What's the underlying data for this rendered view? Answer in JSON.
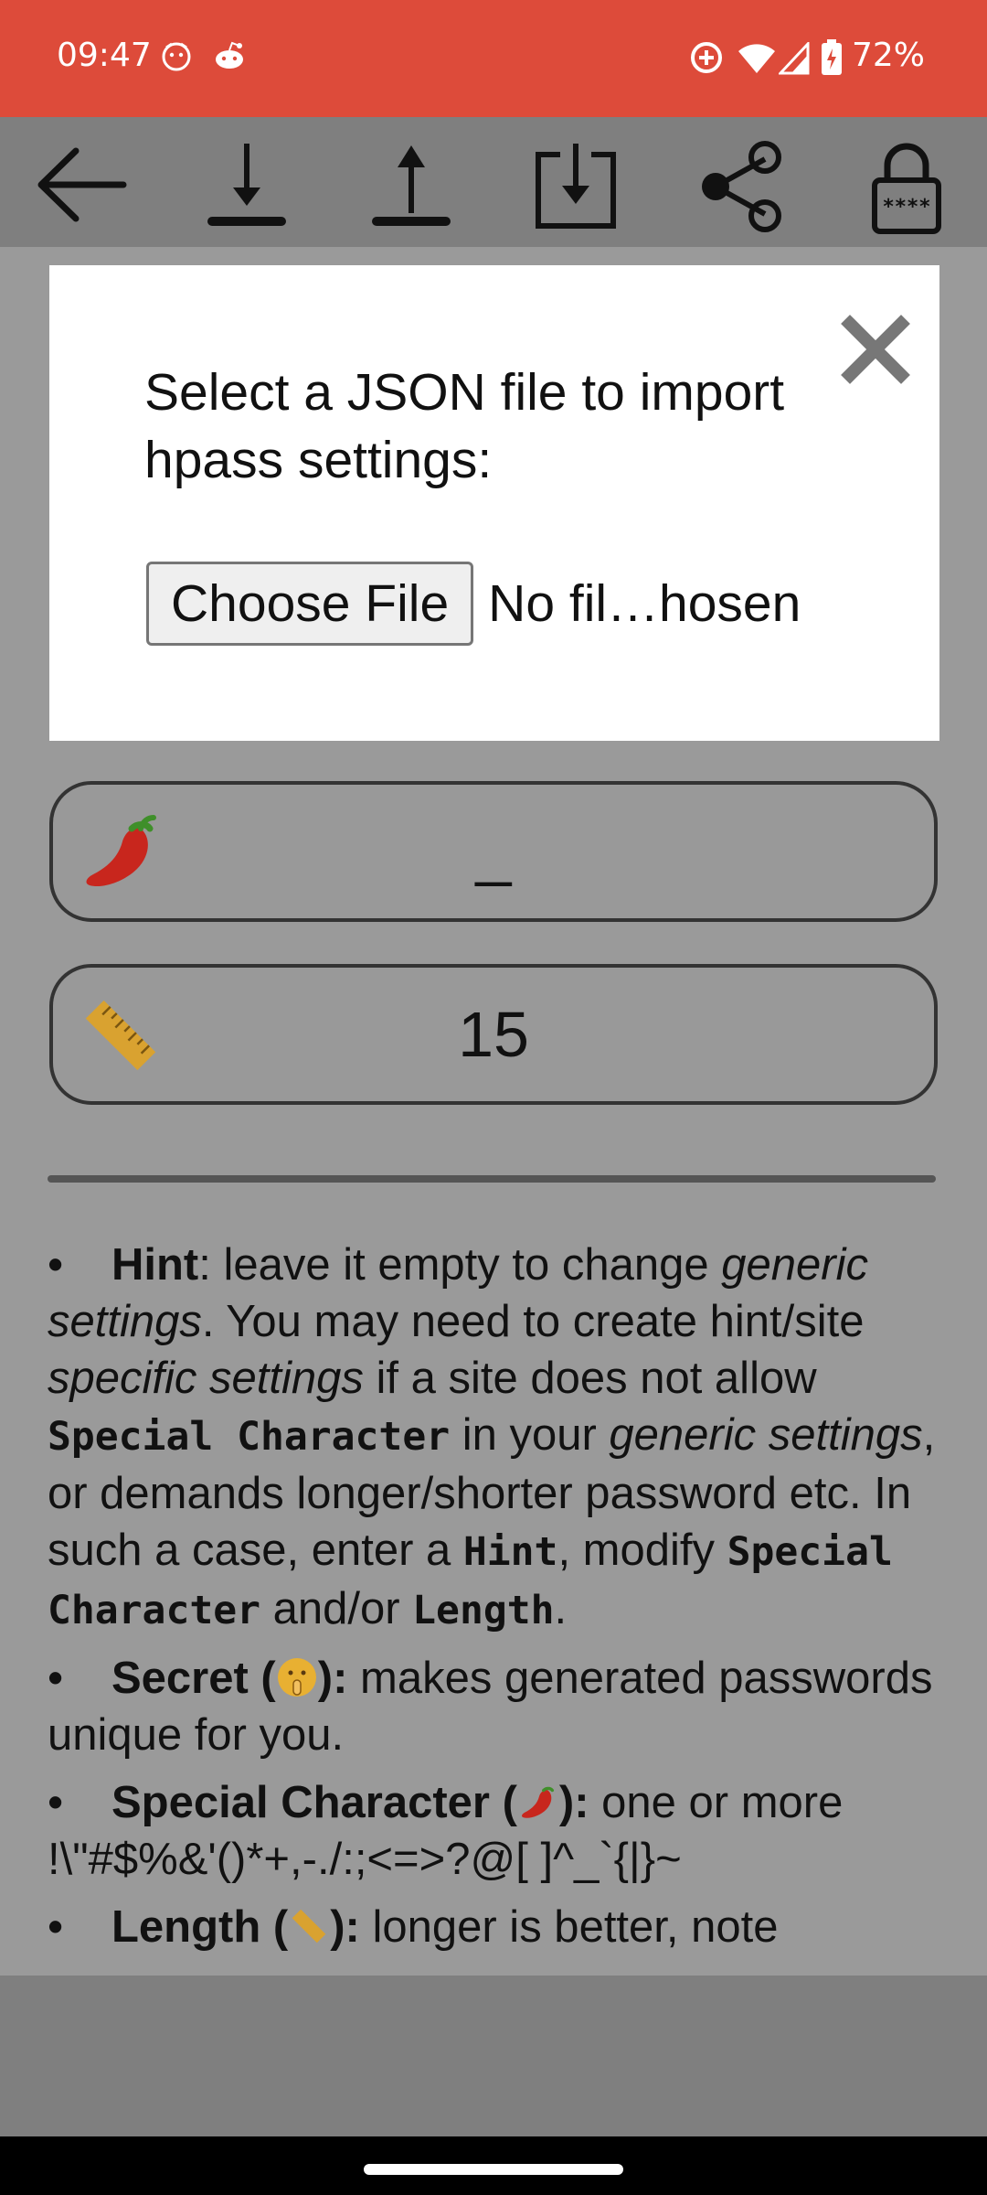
{
  "status_bar": {
    "time": "09:47",
    "battery": "72%",
    "icons": [
      "notification-smiley-icon",
      "reddit-icon",
      "data-saver-icon",
      "wifi-icon",
      "signal-icon",
      "battery-charging-icon"
    ]
  },
  "toolbar": {
    "icons": [
      "back-arrow-icon",
      "download-icon",
      "upload-icon",
      "import-icon",
      "share-icon",
      "lock-icon"
    ]
  },
  "dialog": {
    "title": "Select a JSON file to import hpass settings:",
    "choose_file_label": "Choose File",
    "file_status": "No fil…hosen",
    "close_icon": "close-icon"
  },
  "fields": {
    "special_character": {
      "icon": "chili-pepper-icon",
      "value": "_"
    },
    "length": {
      "icon": "ruler-icon",
      "value": "15"
    }
  },
  "help": {
    "hint": {
      "title": "Hint",
      "t1": ": leave it empty to change ",
      "generic_settings": "generic settings",
      "t2": ". You may need to create hint/site ",
      "specific_settings": "specific settings",
      "t3": " if a site does not allow ",
      "special_character_code": "Special Character",
      "t4": " in your ",
      "generic_settings_2": "generic settings",
      "t5": ", or demands longer/shorter password etc. In such a case, enter a ",
      "hint_code": "Hint",
      "t6": ", modify ",
      "special_character_code_2": "Special Character",
      "t7": " and/or ",
      "length_code": "Length",
      "t8": "."
    },
    "secret": {
      "title": "Secret (",
      "title_end": "):",
      "text": " makes generated passwords unique for you."
    },
    "special": {
      "title": "Special Character (",
      "title_end": "):",
      "text": " one or more !\\\"#$%&'()*+,-./:;<=>?@[ ]^_`{|}~"
    },
    "length": {
      "title": "Length (",
      "title_end": "):",
      "text": " longer is better, note"
    }
  },
  "colors": {
    "status_bar": "#dd4b3a",
    "toolbar": "#7f7f7f",
    "overlay": "#9a9a9a",
    "dialog_bg": "#ffffff"
  }
}
